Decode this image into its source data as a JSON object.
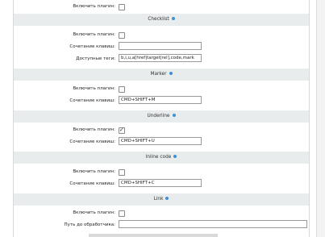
{
  "common": {
    "enable_label": "Включить плагин:",
    "hotkey_label": "Сочетание клавиш:"
  },
  "top": {
    "enable_checked": false
  },
  "checklist": {
    "title": "Checklist",
    "enable_checked": false,
    "hotkey_value": "",
    "tags_label": "Доступные теги:",
    "tags_value": "b,i,u,a[href|target|rel],code,mark"
  },
  "marker": {
    "title": "Marker",
    "enable_checked": false,
    "hotkey_value": "CMD+SHIFT+M"
  },
  "underline": {
    "title": "Underline",
    "enable_checked": true,
    "hotkey_value": "CMD+SHIFT+U"
  },
  "inline_code": {
    "title": "Inline code",
    "enable_checked": false,
    "hotkey_value": "CMD+SHIFT+C"
  },
  "link": {
    "title": "Link",
    "enable_checked": false,
    "handler_label": "Путь до обработчика:",
    "handler_value": ""
  },
  "icons": {
    "info": "info-icon"
  },
  "colors": {
    "header_bg": "#e8ecec",
    "info_icon": "#3d8fd6"
  }
}
